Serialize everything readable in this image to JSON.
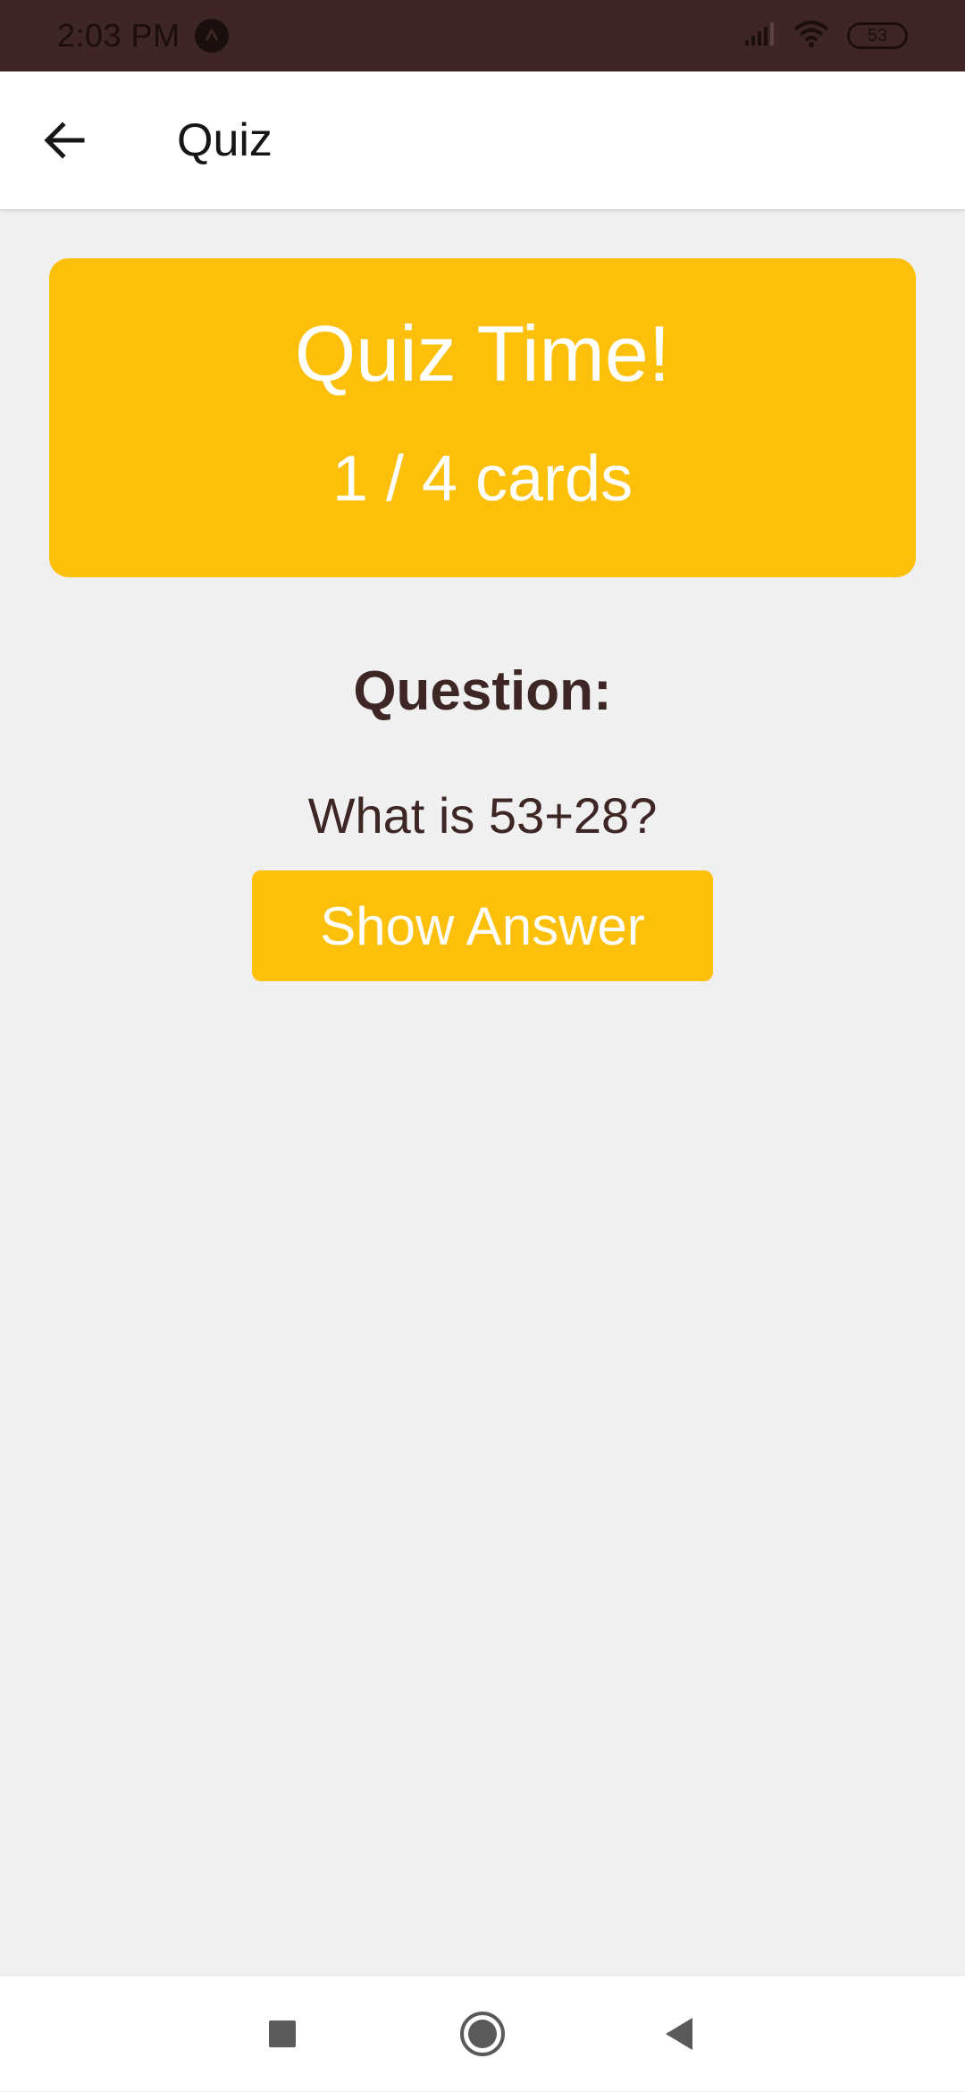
{
  "status_bar": {
    "time": "2:03 PM",
    "battery": "53",
    "icons": [
      "app-notification-icon",
      "signal-icon",
      "wifi-icon",
      "battery-icon"
    ]
  },
  "app_bar": {
    "back_icon": "arrow-left-icon",
    "title": "Quiz"
  },
  "quiz_card": {
    "title": "Quiz Time!",
    "progress": "1 / 4 cards"
  },
  "question": {
    "label": "Question:",
    "text": "What is 53+28?"
  },
  "actions": {
    "show_answer_label": "Show Answer"
  },
  "nav_bar": {
    "icons": [
      "recents-square-icon",
      "home-circle-icon",
      "back-triangle-icon"
    ]
  },
  "colors": {
    "status_bar": "#3d2624",
    "accent": "#fcc00a",
    "text_dark": "#3d2624",
    "background": "#f0f0f1",
    "white": "#ffffff"
  }
}
